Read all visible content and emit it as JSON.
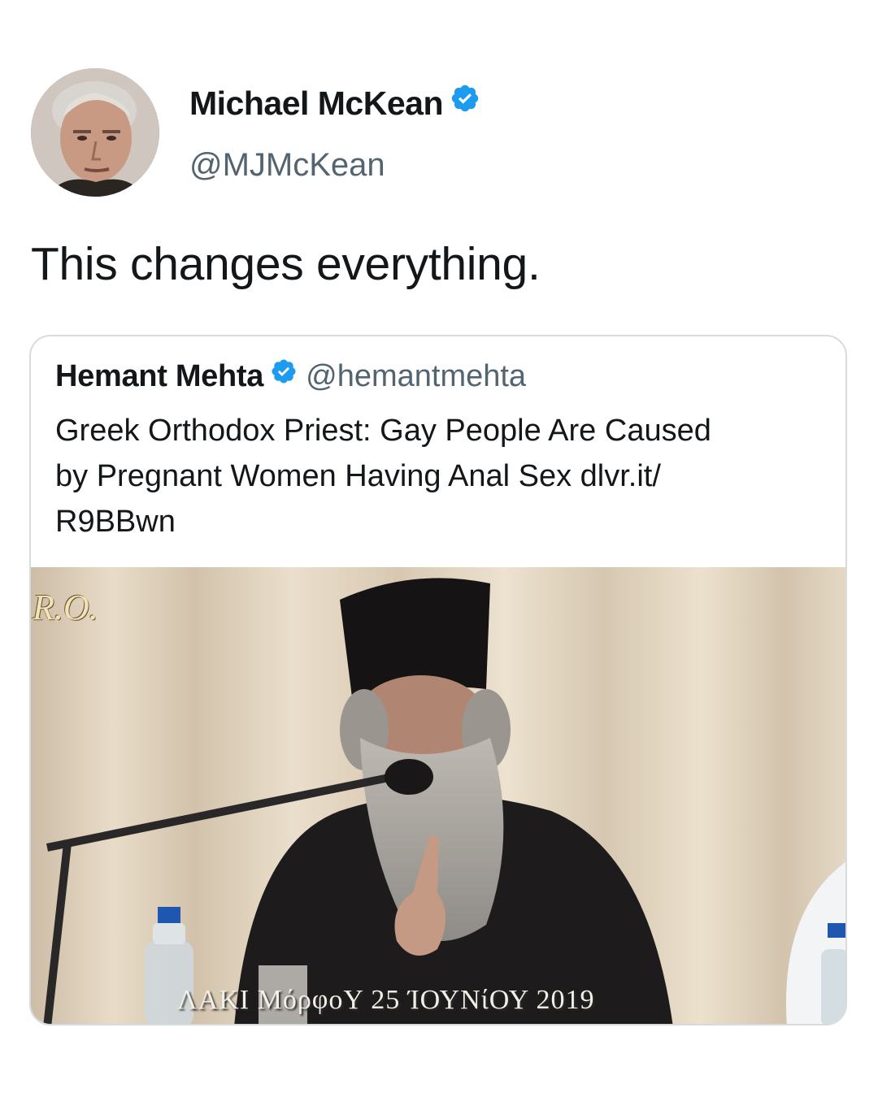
{
  "tweet": {
    "author": {
      "name": "Michael McKean",
      "handle": "@MJMcKean",
      "verified": true
    },
    "text": "This changes everything."
  },
  "quoted_tweet": {
    "author": {
      "name": "Hemant Mehta",
      "handle": "@hemantmehta",
      "verified": true
    },
    "text": "Greek Orthodox Priest: Gay People Are Caused\nby Pregnant Women Having Anal Sex dlvr.it/\nR9BBwn",
    "media": {
      "watermark": "R.O.",
      "caption": "ΛΑΚΙ ΜόρφοΥ 25 ΊΟΥΝίΟΥ 2019"
    }
  },
  "colors": {
    "text": "#14171a",
    "secondary_text": "#536471",
    "verified_badge": "#1d9bf0",
    "card_border": "#d6dbe0"
  },
  "icons": {
    "verified": "verified-badge-icon"
  }
}
